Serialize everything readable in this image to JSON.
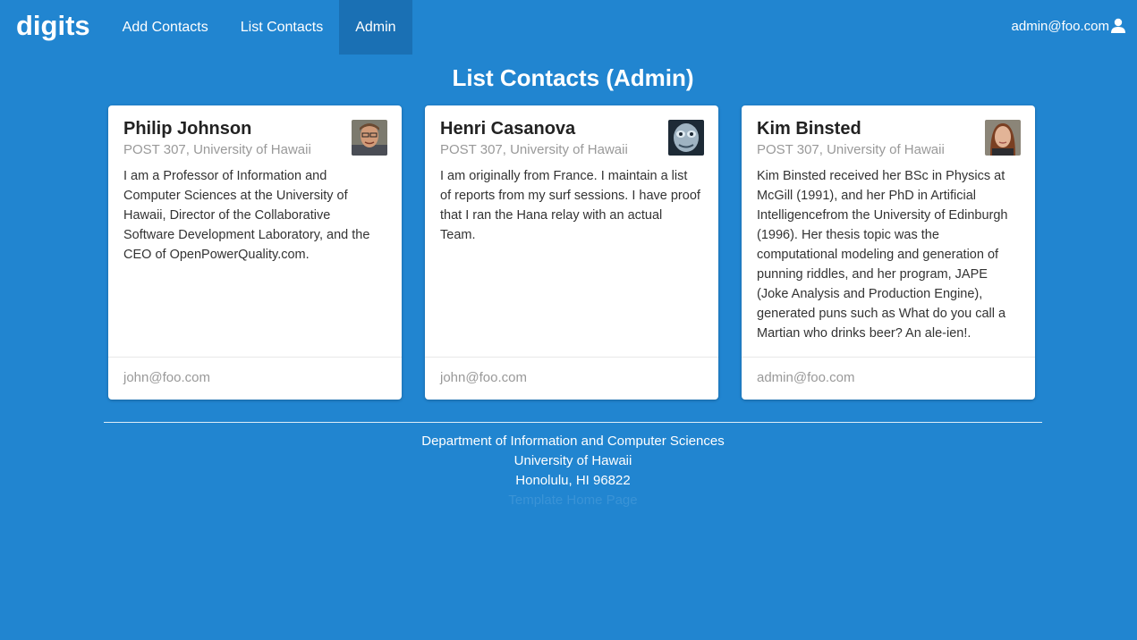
{
  "nav": {
    "brand": "digits",
    "items": [
      {
        "label": "Add Contacts",
        "active": false
      },
      {
        "label": "List Contacts",
        "active": false
      },
      {
        "label": "Admin",
        "active": true
      }
    ],
    "user": "admin@foo.com",
    "user_icon": "user-icon"
  },
  "page": {
    "title": "List Contacts (Admin)"
  },
  "contacts": [
    {
      "name": "Philip Johnson",
      "address": "POST 307, University of Hawaii",
      "description": "I am a Professor of Information and Computer Sciences at the University of Hawaii, Director of the Collaborative Software Development Laboratory, and the CEO of OpenPowerQuality.com.",
      "owner": "john@foo.com"
    },
    {
      "name": "Henri Casanova",
      "address": "POST 307, University of Hawaii",
      "description": "I am originally from France. I maintain a list of reports from my surf sessions. I have proof that I ran the Hana relay with an actual Team.",
      "owner": "john@foo.com"
    },
    {
      "name": "Kim Binsted",
      "address": "POST 307, University of Hawaii",
      "description": "Kim Binsted received her BSc in Physics at McGill (1991), and her PhD in Artificial Intelligencefrom the University of Edinburgh (1996). Her thesis topic was the computational modeling and generation of punning riddles, and her program, JAPE (Joke Analysis and Production Engine), generated puns such as What do you call a Martian who drinks beer? An ale-ien!.",
      "owner": "admin@foo.com"
    }
  ],
  "footer": {
    "line1": "Department of Information and Computer Sciences",
    "line2": "University of Hawaii",
    "line3": "Honolulu, HI 96822",
    "link": "Template Home Page"
  },
  "colors": {
    "background": "#2185d0",
    "active_nav": "#1a70b4"
  }
}
